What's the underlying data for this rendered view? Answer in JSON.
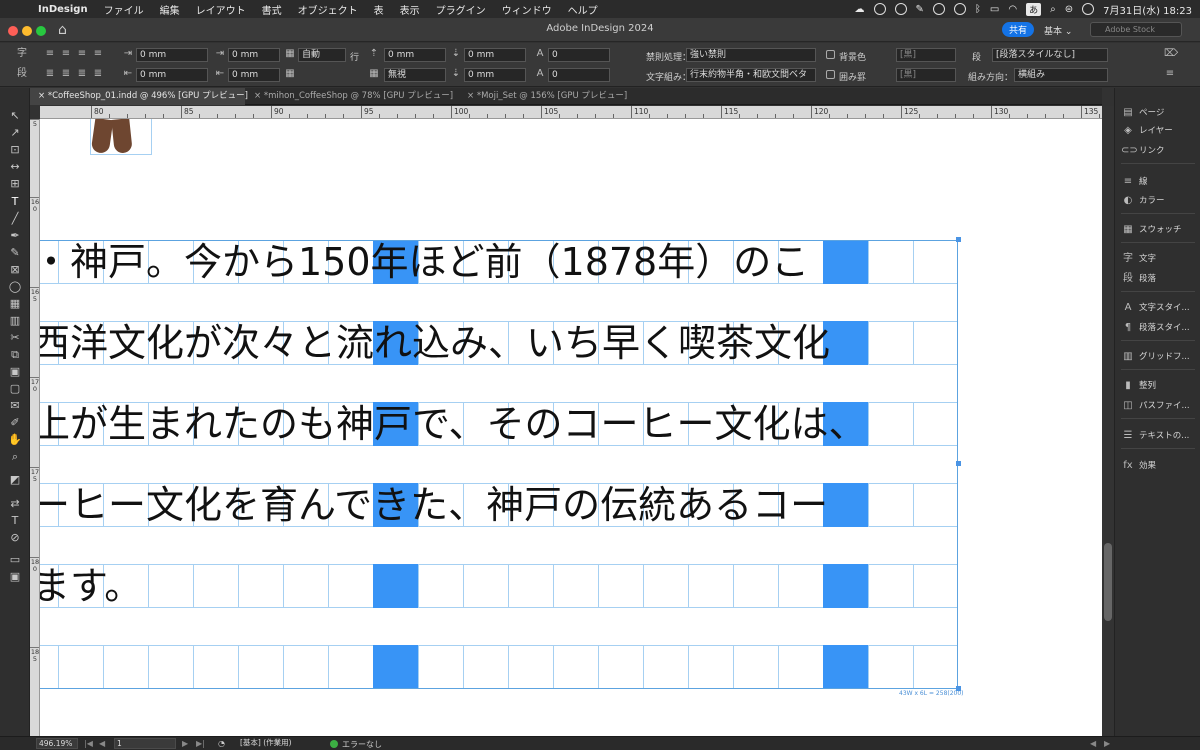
{
  "menubar": {
    "app": "InDesign",
    "items": [
      "ファイル",
      "編集",
      "レイアウト",
      "書式",
      "オブジェクト",
      "表",
      "表示",
      "プラグイン",
      "ウィンドウ",
      "ヘルプ"
    ],
    "input_mode": "あ",
    "datetime": "7月31日(水)  18:23"
  },
  "titlebar": {
    "title": "Adobe InDesign 2024",
    "share_label": "共有",
    "workspace": "基本 ⌄",
    "search_placeholder": "Adobe Stock"
  },
  "control": {
    "row1": {
      "indent_left": "0 mm",
      "indent_first": "0 mm",
      "leading": "自動",
      "row_label": "行",
      "space_before": "0 mm",
      "space_after": "0 mm",
      "dropcap_lines": "0",
      "kinsoku_label": "禁則処理：",
      "kinsoku_value": "強い禁則",
      "bg_color_label": "背景色",
      "swatch1": "[黒]",
      "para_style": "[段落スタイルなし]"
    },
    "row2": {
      "indent_right": "0 mm",
      "indent_last": "0 mm",
      "grid": "無視",
      "space_after2": "0 mm",
      "dropcap_chars": "0",
      "mojikumi_label": "文字組み：",
      "mojikumi_value": "行末約物半角・和欧文間ベタ",
      "frame_label": "囲み罫",
      "swatch2": "[黒]",
      "direction_label": "組み方向：",
      "direction_value": "横組み"
    },
    "para_label": "段"
  },
  "tabs": [
    {
      "label": "*CoffeeShop_01.indd @ 496% [GPU プレビュー]"
    },
    {
      "label": "*mihon_CoffeeShop @ 78% [GPU プレビュー]"
    },
    {
      "label": "*Moji_Set @ 156% [GPU プレビュー]"
    }
  ],
  "ruler": {
    "h_labels": [
      "80",
      "85",
      "90",
      "95",
      "100",
      "105",
      "110",
      "115",
      "120",
      "125",
      "130",
      "135"
    ],
    "v_labels": [
      "5",
      "160",
      "165",
      "170",
      "175",
      "180",
      "185"
    ]
  },
  "text_lines": [
    "・神戸。今から150年ほど前（1878年）のこ",
    "西洋文化が次々と流れ込み、いち早く喫茶文化",
    "上が生まれたのも神戸で、そのコーヒー文化は、",
    "ーヒー文化を育んできた、神戸の伝統あるコー",
    "ます。",
    ""
  ],
  "frame_info": "43W x 6L = 258(200)",
  "panels": [
    {
      "icon": "▤",
      "label": "ページ"
    },
    {
      "icon": "◈",
      "label": "レイヤー"
    },
    {
      "icon": "⊂⊃",
      "label": "リンク"
    },
    {
      "icon": "≡",
      "label": "線"
    },
    {
      "icon": "◐",
      "label": "カラー"
    },
    {
      "icon": "▦",
      "label": "スウォッチ"
    },
    {
      "icon": "字",
      "label": "文字"
    },
    {
      "icon": "段",
      "label": "段落"
    },
    {
      "icon": "A",
      "label": "文字スタイ..."
    },
    {
      "icon": "¶",
      "label": "段落スタイ..."
    },
    {
      "icon": "▥",
      "label": "グリッドフ..."
    },
    {
      "icon": "▮",
      "label": "整列"
    },
    {
      "icon": "◫",
      "label": "パスファイ..."
    },
    {
      "icon": "☰",
      "label": "テキストの..."
    },
    {
      "icon": "fx",
      "label": "効果"
    }
  ],
  "status": {
    "zoom": "496.19%",
    "page": "1",
    "style": "[基本] (作業用)",
    "preflight": "エラーなし"
  }
}
